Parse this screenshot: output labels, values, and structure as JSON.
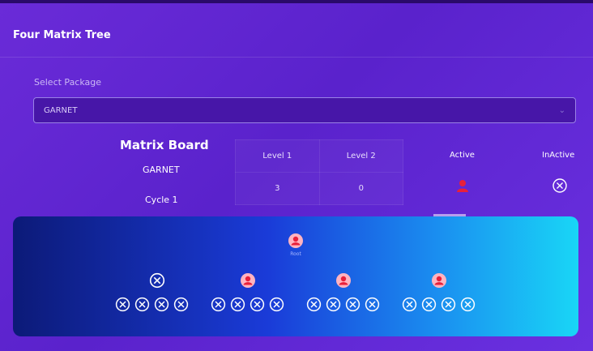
{
  "page": {
    "title": "Four Matrix Tree"
  },
  "select": {
    "label": "Select Package",
    "value": "GARNET"
  },
  "matrix": {
    "title": "Matrix Board",
    "package": "GARNET",
    "cycle": "Cycle 1",
    "levels": [
      {
        "label": "Level 1",
        "value": "3"
      },
      {
        "label": "Level 2",
        "value": "0"
      }
    ],
    "legend": {
      "active_label": "Active",
      "inactive_label": "InActive"
    }
  },
  "tree": {
    "root_label": "Root",
    "root_icon": "user-icon",
    "branches": [
      {
        "status": "inactive",
        "slots": [
          "inactive",
          "inactive",
          "inactive",
          "inactive"
        ]
      },
      {
        "status": "active",
        "slots": [
          "inactive",
          "inactive",
          "inactive",
          "inactive"
        ]
      },
      {
        "status": "active",
        "slots": [
          "inactive",
          "inactive",
          "inactive",
          "inactive"
        ]
      },
      {
        "status": "active",
        "slots": [
          "inactive",
          "inactive",
          "inactive",
          "inactive"
        ]
      }
    ]
  },
  "colors": {
    "active": "#e8203a",
    "inactive": "#ffffff",
    "accent": "#5a22cc"
  }
}
